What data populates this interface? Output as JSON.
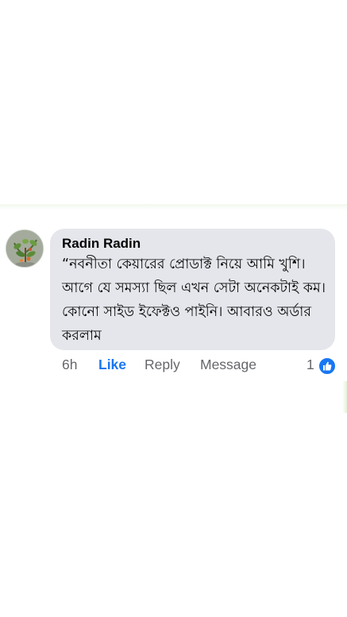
{
  "comment": {
    "author": "Radin Radin",
    "text": "“নবনীতা কেয়ারের প্রোডাক্ট নিয়ে আমি খুশি। আগে যে সমস্যা ছিল এখন সেটা অনেকটাই কম। কোনো সাইড ইফেক্টও পাইনি। আবারও অর্ডার করলাম",
    "time": "6h",
    "like_label": "Like",
    "reply_label": "Reply",
    "message_label": "Message",
    "reaction_count": "1",
    "reaction_icon": "thumbs-up-icon"
  },
  "colors": {
    "bubble": "#e4e6eb",
    "accent": "#1877f2",
    "meta_text": "#65676b",
    "text": "#050505"
  }
}
